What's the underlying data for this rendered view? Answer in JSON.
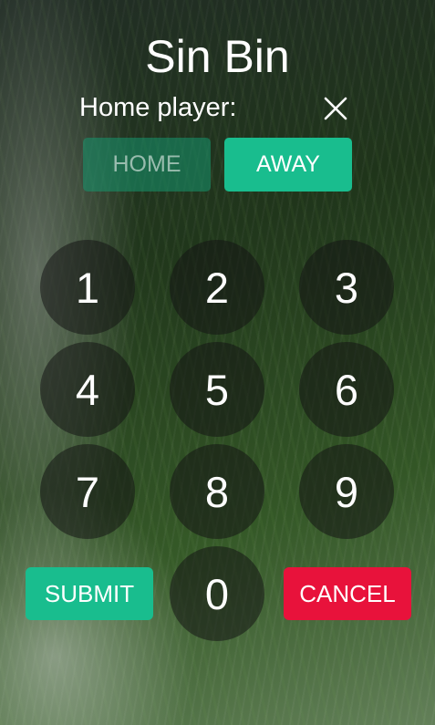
{
  "dialog": {
    "title": "Sin Bin",
    "subtitle": "Home player:",
    "close_icon": "close-icon"
  },
  "teams": {
    "home_label": "HOME",
    "away_label": "AWAY",
    "selected": "AWAY"
  },
  "keypad": {
    "keys": [
      "1",
      "2",
      "3",
      "4",
      "5",
      "6",
      "7",
      "8",
      "9",
      "0"
    ]
  },
  "actions": {
    "submit_label": "SUBMIT",
    "cancel_label": "CANCEL"
  },
  "colors": {
    "accent": "#19bd8e",
    "danger": "#e8123b"
  }
}
